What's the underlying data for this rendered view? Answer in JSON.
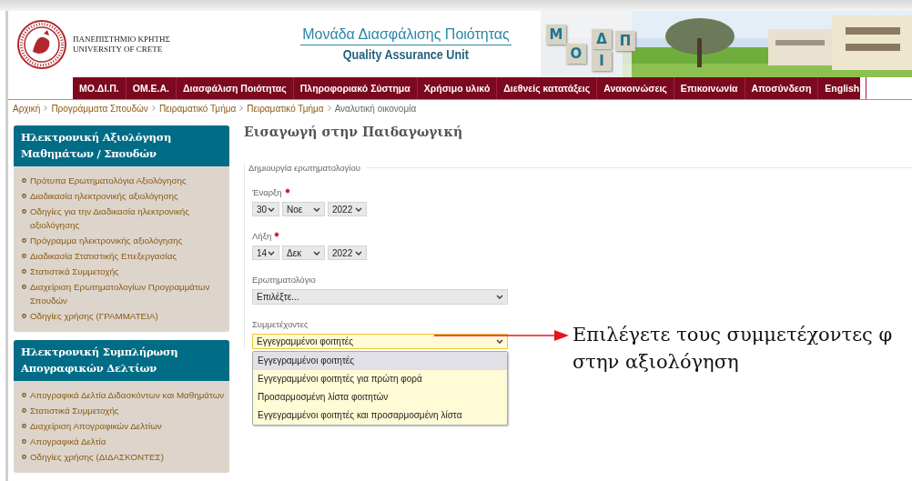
{
  "header": {
    "university": [
      "ΠΑΝΕΠΙΣΤΗΜΙΟ ΚΡΗΤΗΣ",
      "UNIVERSITY OF CRETE"
    ],
    "unit_title": "Μονάδα Διασφάλισης Ποιότητας",
    "unit_subtitle": "Quality Assurance Unit",
    "logo_letters": [
      "Μ",
      "Ο",
      "Δ",
      "Ι",
      "Π"
    ]
  },
  "nav": [
    {
      "label": "ΜΟ.ΔΙ.Π."
    },
    {
      "label": "ΟΜ.Ε.Α."
    },
    {
      "label": "Διασφάλιση Ποιότητας"
    },
    {
      "label": "Πληροφοριακό Σύστημα"
    },
    {
      "label": "Χρήσιμο υλικό"
    },
    {
      "label": "Διεθνείς κατατάξεις"
    },
    {
      "label": "Ανακοινώσεις"
    },
    {
      "label": "Επικοινωνία"
    },
    {
      "label": "Αποσύνδεση"
    },
    {
      "label": "English"
    }
  ],
  "breadcrumb": [
    "Αρχική",
    "Προγράμματα Σπουδών",
    "Πειραματικό Τμήμα",
    "Πειραματικό Τμήμα",
    "Αναλυτική οικονομία"
  ],
  "sidebar": [
    {
      "title": "Ηλεκτρονική Αξιολόγηση Μαθημάτων / Σπουδών",
      "items": [
        "Πρότυπα Ερωτηματολόγια Αξιολόγησης",
        "Διαδικασία ηλεκτρονικής αξιολόγησης",
        "Οδηγίες για την Διαδικασία ηλεκτρονικής αξιολόγησης",
        "Πρόγραμμα ηλεκτρονικής αξιολόγησης",
        "Διαδικασία Στατιστικής Επεξεργασίας",
        "Στατιστικά Συμμετοχής",
        "Διαχείριση Ερωτηματολογίων Προγραμμάτων Σπουδών",
        "Οδηγίες χρήσης (ΓΡΑΜΜΑΤΕΙΑ)"
      ]
    },
    {
      "title": "Ηλεκτρονική Συμπλήρωση Απογραφικών Δελτίων",
      "items": [
        "Απογραφικά Δελτία Διδασκόντων και Μαθημάτων",
        "Στατιστικά Συμμετοχής",
        "Διαχείριση Απογραφικών Δελτίων",
        "Απογραφικά Δελτία",
        "Οδηγίες χρήσης (ΔΙΔΑΣΚΟΝΤΕΣ)"
      ]
    }
  ],
  "page_title": "Εισαγωγή στην Παιδαγωγική",
  "form": {
    "legend": "Δημιουργία ερωτηματολογίου",
    "fields": [
      {
        "kind": "date",
        "label": "Έναρξη",
        "required": true,
        "day": "30",
        "month": "Νοε",
        "year": "2022"
      },
      {
        "kind": "date",
        "label": "Λήξη",
        "required": true,
        "day": "14",
        "month": "Δεκ",
        "year": "2022"
      },
      {
        "kind": "select",
        "label": "Ερωτηματολόγιο",
        "value": "Επιλέξτε..."
      },
      {
        "kind": "dropdown",
        "label": "Συμμετέχοντες",
        "value": "Εγγεγραμμένοι φοιτητές",
        "expanded": true,
        "options": [
          {
            "label": "Εγγεγραμμένοι φοιτητές",
            "selected": true
          },
          {
            "label": "Εγγεγραμμένοι φοιτητές για πρώτη φορά",
            "selected": false
          },
          {
            "label": "Προσαρμοσμένη λίστα φοιτητών",
            "selected": false
          },
          {
            "label": "Εγγεγραμμένοι φοιτητές και προσαρμοσμένη λίστα",
            "selected": false
          }
        ]
      }
    ]
  },
  "annotation": [
    "Επιλέγετε τους συμμετέχοντες φ",
    "στην αξιολόγηση"
  ]
}
